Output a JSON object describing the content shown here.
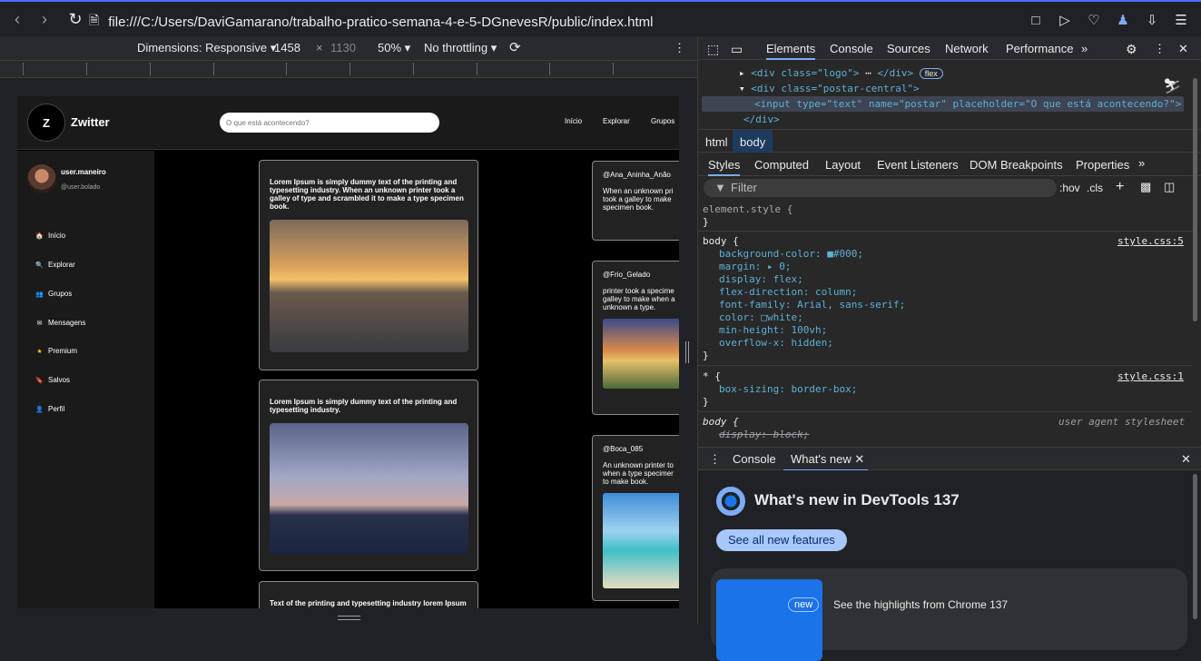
{
  "browser": {
    "url": "file:///C:/Users/DaviGamarano/trabalho-pratico-semana-4-e-5-DGnevesR/public/index.html",
    "icons": [
      "back-icon",
      "forward-icon",
      "reload-icon",
      "page-icon",
      "screenshot-icon",
      "play-icon",
      "heart-icon",
      "profile-icon",
      "download-icon",
      "menu-icon"
    ]
  },
  "device_toolbar": {
    "dimensions_label": "Dimensions: Responsive",
    "width": "1458",
    "times": "×",
    "height": "1130",
    "zoom": "50%",
    "throttling": "No throttling"
  },
  "site": {
    "logo_letter": "Z",
    "brand": "Zwitter",
    "search_placeholder": "O que está acontecendo?",
    "nav": [
      "Início",
      "Explorar",
      "Grupos"
    ],
    "user_name": "user.maneiro",
    "user_handle": "@user.bolado",
    "menu": [
      {
        "icon": "🏠",
        "label": "Início"
      },
      {
        "icon": "🔍",
        "label": "Explorar"
      },
      {
        "icon": "👥",
        "label": "Grupos"
      },
      {
        "icon": "✉",
        "label": "Mensagens"
      },
      {
        "icon": "★",
        "label": "Premium"
      },
      {
        "icon": "🔖",
        "label": "Salvos"
      },
      {
        "icon": "👤",
        "label": "Perfil"
      }
    ],
    "posts": [
      {
        "text": "Lorem Ipsum is simply dummy text of the printing and typesetting industry. When an unknown printer took a galley of type and scrambled it to make a type specimen book."
      },
      {
        "text": "Lorem Ipsum is simply dummy text of the printing and typesetting industry."
      },
      {
        "text": "Text of the printing and typesetting industry lorem Ipsum"
      }
    ],
    "right_cards": [
      {
        "handle": "@Ana_Aninha_Anão",
        "text": "When an unknown pri\ntook a galley to make\nspecimen book."
      },
      {
        "handle": "@Frio_Gelado",
        "text": "printer took a specime\ngalley to make when a\nunknown a type."
      },
      {
        "handle": "@Boca_085",
        "text": "An unknown printer to\nwhen a type specimer\nto make book."
      }
    ]
  },
  "devtools": {
    "tabs": [
      "Elements",
      "Console",
      "Sources",
      "Network",
      "Performance"
    ],
    "active_tab": "Elements",
    "dom": {
      "line1_tag": "<div class=\"logo\">",
      "line1_end": "</div>",
      "line1_badge": "flex",
      "line2": "<div class=\"postar-central\">",
      "line3": "<input type=\"text\" name=\"postar\" placeholder=\"O que está acontecendo?\">",
      "line4": "</div>"
    },
    "breadcrumb": [
      "html",
      "body"
    ],
    "subtabs": [
      "Styles",
      "Computed",
      "Layout",
      "Event Listeners",
      "DOM Breakpoints",
      "Properties"
    ],
    "filter_placeholder": "Filter",
    "hov": ":hov",
    "cls": ".cls",
    "rules": {
      "element_style": "element.style {",
      "close": "}",
      "body_sel": "body {",
      "body_src": "style.css:5",
      "body_props": [
        "background-color: ■#000;",
        "margin: ▸ 0;",
        "display: flex;",
        "flex-direction: column;",
        "font-family: Arial, sans-serif;",
        "color: □white;",
        "min-height: 100vh;",
        "overflow-x: hidden;"
      ],
      "star_sel": "* {",
      "star_src": "style.css:1",
      "star_prop": "box-sizing: border-box;",
      "ua_sel": "body {",
      "ua_src": "user agent stylesheet",
      "ua_prop": "display: block;"
    },
    "drawer_tabs": [
      "Console",
      "What's new"
    ],
    "whats_new_title": "What's new in DevTools 137",
    "see_all": "See all new features",
    "badge_new": "new",
    "highlight": "See the highlights from Chrome 137"
  }
}
